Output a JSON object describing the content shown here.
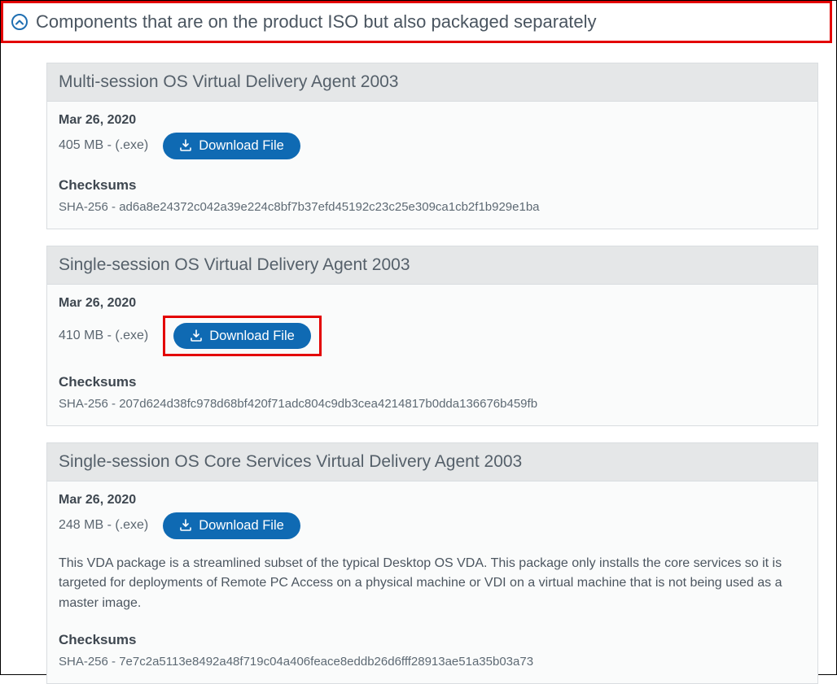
{
  "section": {
    "title": "Components that are on the product ISO but also packaged separately"
  },
  "common": {
    "download_label": "Download File",
    "checksums_heading": "Checksums"
  },
  "cards": [
    {
      "title": "Multi-session OS Virtual Delivery Agent 2003",
      "date": "Mar 26, 2020",
      "size": "405 MB - (.exe)",
      "checksum": "SHA-256 - ad6a8e24372c042a39e224c8bf7b37efd45192c23c25e309ca1cb2f1b929e1ba",
      "description": ""
    },
    {
      "title": "Single-session OS Virtual Delivery Agent 2003",
      "date": "Mar 26, 2020",
      "size": "410 MB - (.exe)",
      "checksum": "SHA-256 - 207d624d38fc978d68bf420f71adc804c9db3cea4214817b0dda136676b459fb",
      "description": ""
    },
    {
      "title": "Single-session OS Core Services Virtual Delivery Agent 2003",
      "date": "Mar 26, 2020",
      "size": "248 MB - (.exe)",
      "checksum": "SHA-256 - 7e7c2a5113e8492a48f719c04a406feace8eddb26d6fff28913ae51a35b03a73",
      "description": "This VDA package is a streamlined subset of the typical Desktop OS VDA. This package only installs the core services so it is targeted for deployments of Remote PC Access on a physical machine or VDI on a virtual machine that is not being used as a master image."
    }
  ]
}
